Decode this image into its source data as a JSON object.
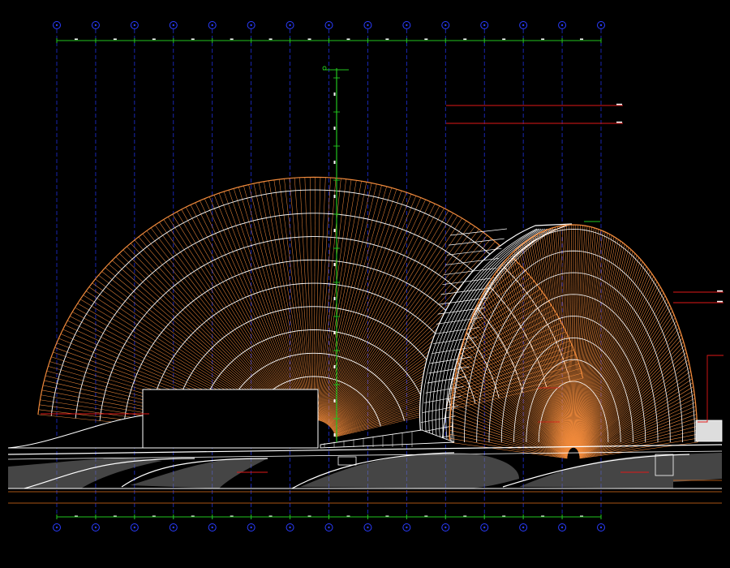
{
  "drawing": {
    "background": "#000000",
    "colors": {
      "grid": "#1f2fd8",
      "grid_marker": "#2a3cff",
      "dimension": "#22c41e",
      "shell_main": "#f08a3c",
      "shell_rib": "#ffffff",
      "leader": "#e01818",
      "ground": "#ffffff",
      "hatch": "#7d7d7d",
      "baseline": "#e0701c"
    },
    "grid_count": 15,
    "annotations_right": [
      "",
      "",
      "",
      "",
      ""
    ],
    "annotations_left": [
      "",
      ""
    ]
  }
}
